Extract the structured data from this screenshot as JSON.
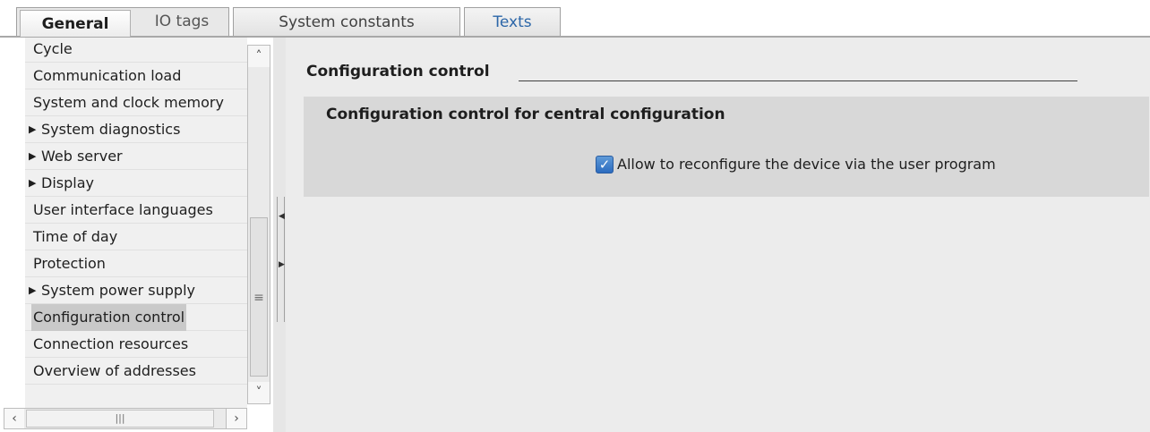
{
  "tabs": {
    "general": "General",
    "io_tags": "IO tags",
    "system_constants": "System constants",
    "texts": "Texts",
    "active": "General"
  },
  "nav": {
    "items": [
      {
        "label": "Cycle",
        "expandable": false
      },
      {
        "label": "Communication load",
        "expandable": false
      },
      {
        "label": "System and clock memory",
        "expandable": false
      },
      {
        "label": "System diagnostics",
        "expandable": true
      },
      {
        "label": "Web server",
        "expandable": true
      },
      {
        "label": "Display",
        "expandable": true
      },
      {
        "label": "User interface languages",
        "expandable": false
      },
      {
        "label": "Time of day",
        "expandable": false
      },
      {
        "label": "Protection",
        "expandable": false
      },
      {
        "label": "System power supply",
        "expandable": true
      },
      {
        "label": "Configuration control",
        "expandable": false,
        "selected": true
      },
      {
        "label": "Connection resources",
        "expandable": false
      },
      {
        "label": "Overview of addresses",
        "expandable": false
      }
    ]
  },
  "icons": {
    "expand": "▶",
    "scroll_up": "˄",
    "scroll_down": "˅",
    "scroll_left": "‹",
    "scroll_right": "›",
    "grip_v": "≡",
    "grip_h": "|||",
    "check": "✓"
  },
  "main": {
    "section_title": "Configuration control",
    "group_title": "Configuration control for central configuration",
    "checkbox_label": "Allow to reconfigure the device via the user program",
    "checkbox_checked": true
  },
  "colors": {
    "selected_bg": "#c9c9c9",
    "checkbox": "#2b6bbf",
    "texts_tab": "#2c66a8"
  }
}
